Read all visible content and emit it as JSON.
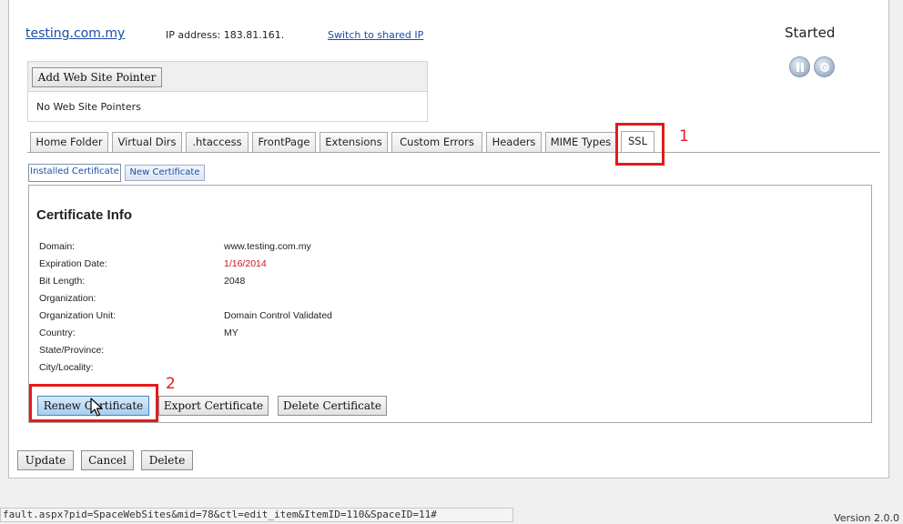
{
  "header": {
    "site_name": "testing.com.my",
    "ip_address": "IP address: 183.81.161.",
    "switch_link": "Switch to shared IP",
    "status": "Started"
  },
  "pointers": {
    "add_button": "Add Web Site Pointer",
    "empty_text": "No Web Site Pointers"
  },
  "tabs": [
    {
      "label": "Home Folder"
    },
    {
      "label": "Virtual Dirs"
    },
    {
      "label": ".htaccess"
    },
    {
      "label": "FrontPage"
    },
    {
      "label": "Extensions"
    },
    {
      "label": "Custom Errors"
    },
    {
      "label": "Headers"
    },
    {
      "label": "MIME Types"
    },
    {
      "label": "SSL"
    }
  ],
  "subtabs": [
    {
      "label": "Installed Certificate"
    },
    {
      "label": "New Certificate"
    }
  ],
  "certificate": {
    "title": "Certificate Info",
    "fields": [
      {
        "label": "Domain:",
        "value": "www.testing.com.my"
      },
      {
        "label": "Expiration Date:",
        "value": "1/16/2014"
      },
      {
        "label": "Bit Length:",
        "value": "2048"
      },
      {
        "label": "Organization:",
        "value": ""
      },
      {
        "label": "Organization Unit:",
        "value": "Domain Control Validated"
      },
      {
        "label": "Country:",
        "value": "MY"
      },
      {
        "label": "State/Province:",
        "value": ""
      },
      {
        "label": "City/Locality:",
        "value": ""
      }
    ],
    "renew_button": "Renew Certificate",
    "export_button": "Export Certificate",
    "delete_button": "Delete Certificate"
  },
  "annotations": {
    "callout_1": "1",
    "callout_2": "2"
  },
  "footer": {
    "update_button": "Update",
    "cancel_button": "Cancel",
    "delete_button": "Delete",
    "status_url": "fault.aspx?pid=SpaceWebSites&mid=78&ctl=edit_item&ItemID=110&SpaceID=11#",
    "version": "Version 2.0.0"
  },
  "colors": {
    "accent": "#1a4ea8",
    "highlight": "#e41b1b",
    "expired": "#c81414"
  },
  "icons": {
    "pause": "pause-icon",
    "stop": "stop-icon",
    "cursor": "pointer-cursor"
  }
}
